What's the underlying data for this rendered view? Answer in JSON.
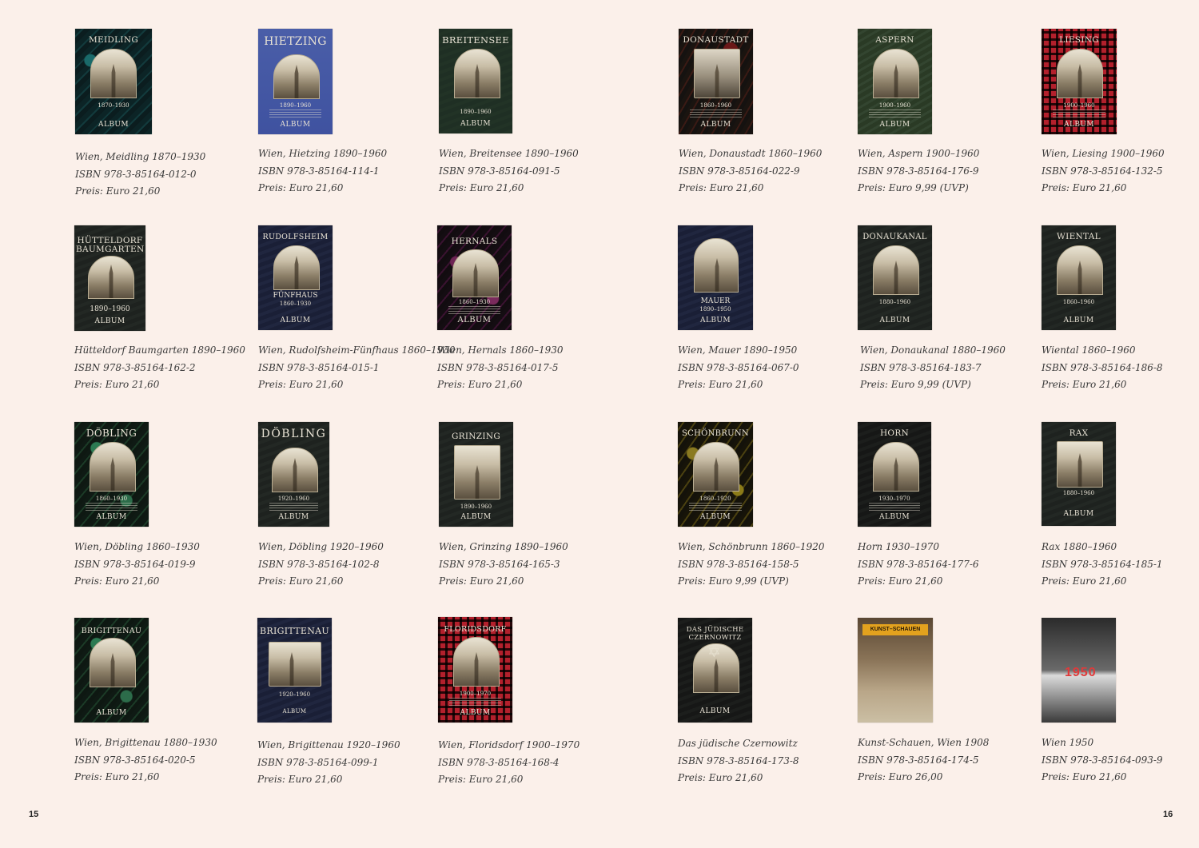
{
  "page_numbers": {
    "left": "15",
    "right": "16"
  },
  "books": [
    {
      "cover": {
        "title": "MEIDLING",
        "years": "1870–1930",
        "album": "ALBUM"
      },
      "title": "Wien, Meidling 1870–1930",
      "isbn": "ISBN 978-3-85164-012-0",
      "price": "Preis: Euro 21,60"
    },
    {
      "cover": {
        "title": "HIETZING",
        "years": "1890–1960",
        "album": "ALBUM"
      },
      "title": "Wien, Hietzing 1890–1960",
      "isbn": "ISBN 978-3-85164-114-1",
      "price": "Preis: Euro 21,60"
    },
    {
      "cover": {
        "title": "BREITENSEE",
        "years": "1890–1960",
        "album": "ALBUM"
      },
      "title": "Wien, Breitensee 1890–1960",
      "isbn": "ISBN 978-3-85164-091-5",
      "price": "Preis: Euro 21,60"
    },
    {
      "cover": {
        "title": "DONAUSTADT",
        "years": "1860–1960",
        "album": "ALBUM"
      },
      "title": "Wien, Donaustadt 1860–1960",
      "isbn": "ISBN 978-3-85164-022-9",
      "price": "Preis: Euro 21,60"
    },
    {
      "cover": {
        "title": "ASPERN",
        "years": "1900–1960",
        "album": "ALBUM"
      },
      "title": "Wien, Aspern 1900–1960",
      "isbn": "ISBN 978-3-85164-176-9",
      "price": "Preis: Euro 9,99 (UVP)"
    },
    {
      "cover": {
        "title": "LIESING",
        "years": "1900–1960",
        "album": "ALBUM"
      },
      "title": "Wien, Liesing 1900–1960",
      "isbn": "ISBN 978-3-85164-132-5",
      "price": "Preis: Euro 21,60"
    },
    {
      "cover": {
        "title": "HÜTTELDORF\nBAUMGARTEN",
        "years": "1890–1960",
        "album": "ALBUM"
      },
      "title": "Hütteldorf Baumgarten 1890–1960",
      "isbn": "ISBN 978-3-85164-162-2",
      "price": "Preis: Euro 21,60"
    },
    {
      "cover": {
        "title": "RUDOLFSHEIM",
        "sub": "FÜNFHAUS",
        "years": "1860–1930",
        "album": "ALBUM"
      },
      "title": "Wien, Rudolfsheim-Fünfhaus 1860–1930",
      "isbn": "ISBN 978-3-85164-015-1",
      "price": "Preis: Euro 21,60"
    },
    {
      "cover": {
        "title": "HERNALS",
        "years": "1860–1930",
        "album": "ALBUM"
      },
      "title": "Wien, Hernals 1860–1930",
      "isbn": "ISBN 978-3-85164-017-5",
      "price": "Preis: Euro 21,60"
    },
    {
      "cover": {
        "title": "",
        "sub": "MAUER",
        "years": "1890–1950",
        "album": "ALBUM"
      },
      "title": "Wien, Mauer 1890–1950",
      "isbn": "ISBN 978-3-85164-067-0",
      "price": "Preis: Euro 21,60"
    },
    {
      "cover": {
        "title": "DONAUKANAL",
        "years": "1880–1960",
        "album": "ALBUM"
      },
      "title": "Wien, Donaukanal 1880–1960",
      "isbn": "ISBN 978-3-85164-183-7",
      "price": "Preis: Euro 9,99 (UVP)"
    },
    {
      "cover": {
        "title": "WIENTAL",
        "years": "1860–1960",
        "album": "ALBUM"
      },
      "title": "Wiental 1860–1960",
      "isbn": "ISBN 978-3-85164-186-8",
      "price": "Preis: Euro 21,60"
    },
    {
      "cover": {
        "title": "DÖBLING",
        "years": "1860–1930",
        "album": "ALBUM"
      },
      "title": "Wien, Döbling 1860–1930",
      "isbn": "ISBN 978-3-85164-019-9",
      "price": "Preis: Euro 21,60"
    },
    {
      "cover": {
        "title": "DÖBLING",
        "years": "1920–1960",
        "album": "ALBUM"
      },
      "title": "Wien, Döbling 1920–1960",
      "isbn": "ISBN 978-3-85164-102-8",
      "price": "Preis: Euro 21,60"
    },
    {
      "cover": {
        "title": "GRINZING",
        "years": "1890–1960",
        "album": "ALBUM"
      },
      "title": "Wien, Grinzing 1890–1960",
      "isbn": "ISBN 978-3-85164-165-3",
      "price": "Preis: Euro 21,60"
    },
    {
      "cover": {
        "title": "SCHÖNBRUNN",
        "years": "1860–1920",
        "album": "ALBUM"
      },
      "title": "Wien, Schönbrunn 1860–1920",
      "isbn": "ISBN 978-3-85164-158-5",
      "price": "Preis: Euro 9,99 (UVP)"
    },
    {
      "cover": {
        "title": "HORN",
        "years": "1930–1970",
        "album": "ALBUM"
      },
      "title": "Horn 1930–1970",
      "isbn": "ISBN 978-3-85164-177-6",
      "price": "Preis: Euro 21,60"
    },
    {
      "cover": {
        "title": "RAX",
        "years": "1880–1960",
        "album": "ALBUM"
      },
      "title": "Rax 1880–1960",
      "isbn": "ISBN 978-3-85164-185-1",
      "price": "Preis: Euro 21,60"
    },
    {
      "cover": {
        "title": "BRIGITTENAU",
        "years": "",
        "album": "ALBUM"
      },
      "title": "Wien, Brigittenau 1880–1930",
      "isbn": "ISBN 978-3-85164-020-5",
      "price": "Preis: Euro 21,60"
    },
    {
      "cover": {
        "title": "BRIGITTENAU",
        "years": "1920–1960",
        "album": "ALBUM"
      },
      "title": "Wien, Brigittenau 1920–1960",
      "isbn": "ISBN 978-3-85164-099-1",
      "price": "Preis: Euro 21,60"
    },
    {
      "cover": {
        "title": "FLORIDSDORF",
        "years": "1900–1970",
        "album": "ALBUM"
      },
      "title": "Wien, Floridsdorf 1900–1970",
      "isbn": "ISBN 978-3-85164-168-4",
      "price": "Preis: Euro 21,60"
    },
    {
      "cover": {
        "title": "DAS JÜDISCHE\nCZERNOWITZ",
        "years": "",
        "album": "ALBUM"
      },
      "title": "Das jüdische Czernowitz",
      "isbn": "ISBN 978-3-85164-173-8",
      "price": "Preis: Euro 21,60"
    },
    {
      "cover": {
        "title": "KUNST–SCHAUEN",
        "years": "",
        "album": ""
      },
      "title": "Kunst-Schauen, Wien 1908",
      "isbn": "ISBN 978-3-85164-174-5",
      "price": "Preis: Euro 26,00"
    },
    {
      "cover": {
        "title": "",
        "badge": "1950",
        "years": "",
        "album": ""
      },
      "title": "Wien 1950",
      "isbn": "ISBN 978-3-85164-093-9",
      "price": "Preis: Euro 21,60"
    }
  ]
}
